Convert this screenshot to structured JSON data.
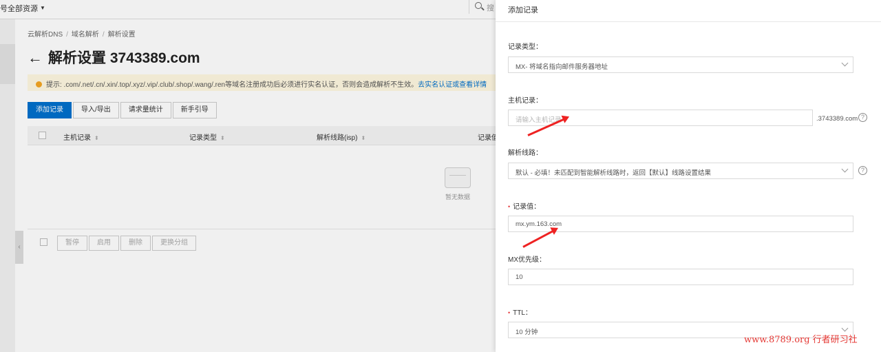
{
  "topbar": {
    "resource_selector": "号全部资源",
    "search_placeholder": "搜"
  },
  "breadcrumb": [
    "云解析DNS",
    "域名解析",
    "解析设置"
  ],
  "page": {
    "title": "解析设置 3743389.com",
    "notice_text": "提示: .com/.net/.cn/.xin/.top/.xyz/.vip/.club/.shop/.wang/.ren等域名注册成功后必须进行实名认证，否则会造成解析不生效。",
    "notice_link": "去实名认证或查看详情"
  },
  "toolbar": {
    "add_record": "添加记录",
    "import_export": "导入/导出",
    "request_stats": "请求量统计",
    "guide": "新手引导"
  },
  "table": {
    "columns": [
      "主机记录",
      "记录类型",
      "解析线路(isp)",
      "记录值"
    ],
    "empty_text": "暂无数据"
  },
  "footer_actions": [
    "暂停",
    "启用",
    "删除",
    "更换分组"
  ],
  "drawer": {
    "title": "添加记录",
    "record_type": {
      "label": "记录类型：",
      "value": "MX- 将域名指向邮件服务器地址"
    },
    "host": {
      "label": "主机记录：",
      "placeholder": "请输入主机记录",
      "suffix": ".3743389.com"
    },
    "line": {
      "label": "解析线路：",
      "value": "默认 - 必填！未匹配到智能解析线路时，返回【默认】线路设置结果"
    },
    "record_value": {
      "label": "记录值：",
      "value": "mx.ym.163.com"
    },
    "mx_priority": {
      "label": "MX优先级：",
      "value": "10"
    },
    "ttl": {
      "label": "TTL：",
      "value": "10 分钟"
    }
  },
  "watermark": "www.8789.org 行者研习社",
  "colors": {
    "primary": "#0070cc",
    "required": "#e4393c",
    "arrow": "#e22222",
    "notice_bg": "#fff8e1"
  }
}
